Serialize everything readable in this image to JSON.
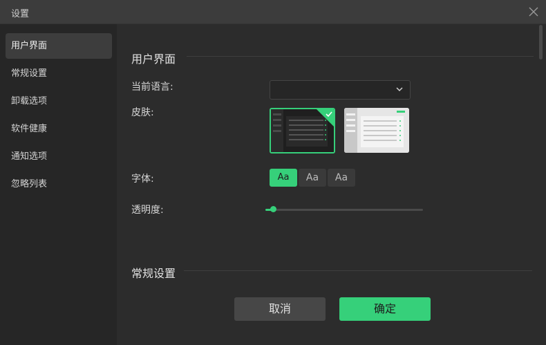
{
  "window": {
    "title": "设置"
  },
  "sidebar": {
    "items": [
      {
        "label": "用户界面",
        "active": true
      },
      {
        "label": "常规设置",
        "active": false
      },
      {
        "label": "卸载选项",
        "active": false
      },
      {
        "label": "软件健康",
        "active": false
      },
      {
        "label": "通知选项",
        "active": false
      },
      {
        "label": "忽略列表",
        "active": false
      }
    ]
  },
  "ui_section": {
    "title": "用户界面",
    "language": {
      "label": "当前语言:",
      "value": ""
    },
    "skin": {
      "label": "皮肤:",
      "options": [
        "dark",
        "light"
      ],
      "selected": "dark"
    },
    "font": {
      "label": "字体:",
      "options": [
        "Aa",
        "Aa",
        "Aa"
      ],
      "selected_index": 0
    },
    "opacity": {
      "label": "透明度:",
      "value": 0.05
    }
  },
  "general_section": {
    "title": "常规设置"
  },
  "footer": {
    "cancel_label": "取消",
    "ok_label": "确定"
  },
  "colors": {
    "accent": "#36d07a",
    "background": "#2c2c2c",
    "sidebar": "#262626",
    "titlebar": "#3c3c3c"
  }
}
